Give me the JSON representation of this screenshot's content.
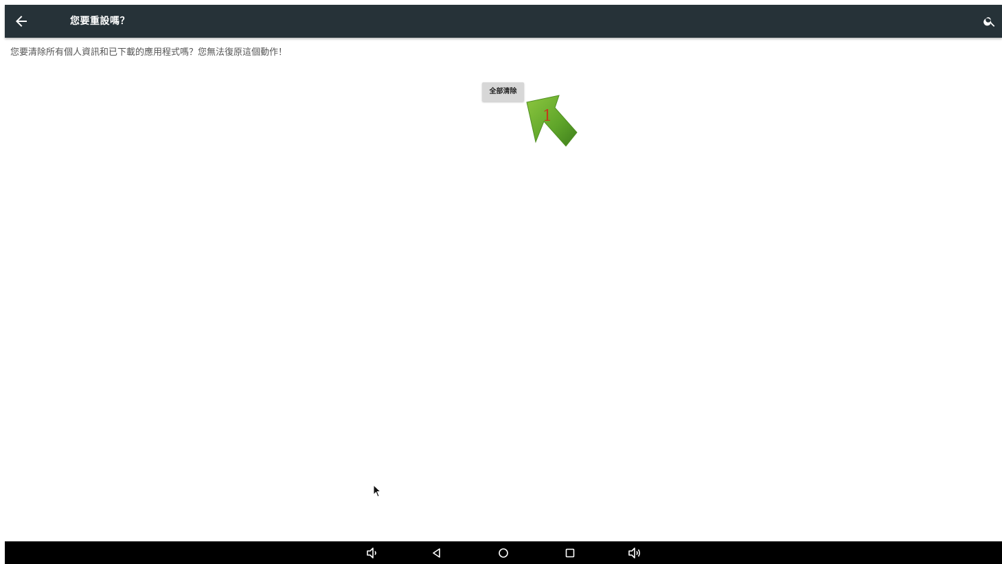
{
  "app_bar": {
    "title": "您要重設嗎？",
    "back_icon": "arrow-back-icon",
    "search_icon": "search-icon",
    "background_color": "#263238"
  },
  "content": {
    "message": "您要清除所有個人資訊和已下載的應用程式嗎？您無法復原這個動作！",
    "erase_button_label": "全部清除"
  },
  "annotation": {
    "step_number": "1",
    "arrow_color": "#5fa52a",
    "step_color": "#c33a1a"
  },
  "nav_bar": {
    "buttons": [
      {
        "name": "volume-down-icon"
      },
      {
        "name": "back-triangle-icon"
      },
      {
        "name": "home-circle-icon"
      },
      {
        "name": "recents-square-icon"
      },
      {
        "name": "volume-up-icon"
      }
    ]
  }
}
